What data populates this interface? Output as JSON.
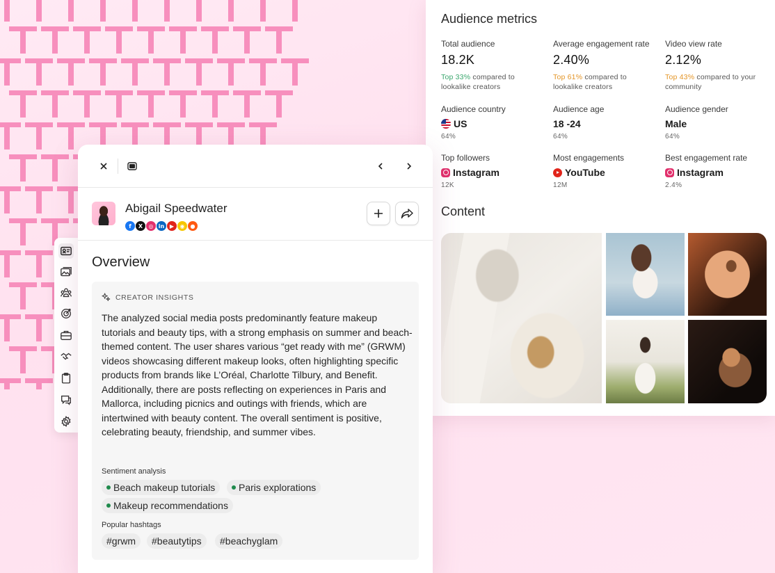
{
  "metrics": {
    "title": "Audience metrics",
    "total_audience": {
      "label": "Total audience",
      "value": "18.2K",
      "highlight": "Top 33%",
      "compare": " compared to lookalike creators",
      "highlight_color": "#3aa76d"
    },
    "engagement_rate": {
      "label": "Average engagement rate",
      "value": "2.40%",
      "highlight": "Top 61%",
      "compare": " compared to lookalike creators",
      "highlight_color": "#e49527"
    },
    "video_view_rate": {
      "label": "Video view rate",
      "value": "2.12%",
      "highlight": "Top 43%",
      "compare": " compared to your community",
      "highlight_color": "#e49527"
    },
    "country": {
      "label": "Audience country",
      "value": "US",
      "sub": "64%",
      "icon": "us-flag-icon"
    },
    "age": {
      "label": "Audience age",
      "value": "18 -24",
      "sub": "64%"
    },
    "gender": {
      "label": "Audience gender",
      "value": "Male",
      "sub": "64%"
    },
    "top_followers": {
      "label": "Top followers",
      "value": "Instagram",
      "sub": "12K",
      "icon": "instagram-icon"
    },
    "most_engagements": {
      "label": "Most engagements",
      "value": "YouTube",
      "sub": "12M",
      "icon": "youtube-icon"
    },
    "best_engagement": {
      "label": "Best engagement rate",
      "value": "Instagram",
      "sub": "2.4%",
      "icon": "instagram-icon"
    }
  },
  "content": {
    "title": "Content",
    "images": [
      "beauty-products-photo",
      "selfie-photo",
      "face-closeup-photo",
      "outfit-photo",
      "serum-dropper-photo"
    ]
  },
  "panel": {
    "profile": {
      "name": "Abigail Speedwater",
      "socials": [
        {
          "name": "facebook-icon",
          "glyph": "f",
          "color": "#1877f2"
        },
        {
          "name": "x-icon",
          "glyph": "X",
          "color": "#111111"
        },
        {
          "name": "instagram-icon",
          "glyph": "◎",
          "color": "#e1306c"
        },
        {
          "name": "linkedin-icon",
          "glyph": "in",
          "color": "#0a66c2"
        },
        {
          "name": "youtube-icon",
          "glyph": "▶",
          "color": "#e1251b"
        },
        {
          "name": "snapchat-icon",
          "glyph": "◉",
          "color": "#f7c600"
        },
        {
          "name": "reddit-icon",
          "glyph": "●",
          "color": "#ff5a12"
        }
      ]
    },
    "overview_title": "Overview",
    "insights": {
      "heading": "CREATOR INSIGHTS",
      "text": "The analyzed social media posts predominantly feature makeup tutorials and beauty tips, with a strong emphasis on summer and beach-themed content. The user shares various “get ready with me” (GRWM) videos showcasing different makeup looks, often highlighting specific products from brands like L’Oréal, Charlotte Tilbury, and Benefit. Additionally, there are posts reflecting on experiences in Paris and Mallorca, including picnics and outings with friends, which are intertwined with beauty content. The overall sentiment is positive, celebrating beauty, friendship, and summer vibes.",
      "sentiment_heading": "Sentiment analysis",
      "sentiments": [
        "Beach makeup tutorials",
        "Paris explorations",
        "Makeup recommendations"
      ],
      "hashtags_heading": "Popular hashtags",
      "hashtags": [
        "#grwm",
        "#beautytips",
        "#beachyglam"
      ]
    }
  },
  "colors": {
    "pattern": "#f78fbd",
    "background": "#ffe6f2",
    "sentiment_dot": "#1f8a4c"
  }
}
